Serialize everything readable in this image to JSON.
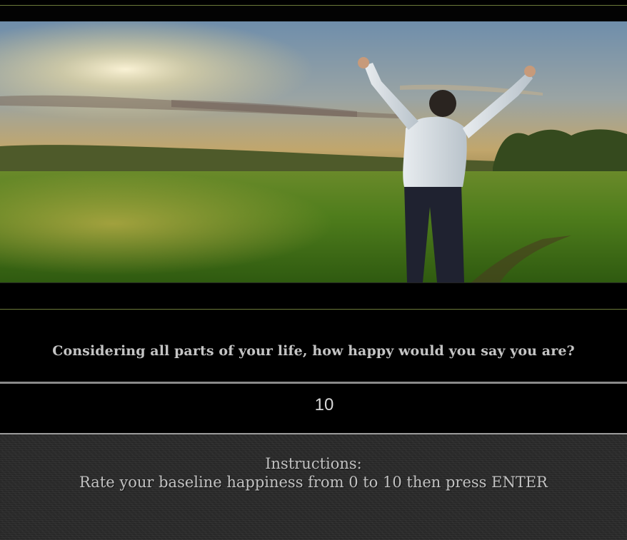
{
  "hero": {
    "image_subject": "person-with-raised-arms-in-sunlit-field"
  },
  "survey": {
    "question": "Considering all parts of your life, how happy would you say you are?",
    "answer_value": "10"
  },
  "instructions": {
    "heading": "Instructions:",
    "body": "Rate your baseline happiness from 0 to 10 then press ENTER"
  },
  "colors": {
    "background": "#000000",
    "accent_rule": "#6b7a3a",
    "question_text": "#c4c4c4",
    "answer_text": "#d6d6d6",
    "instructions_bg": "#2c2c2c"
  }
}
